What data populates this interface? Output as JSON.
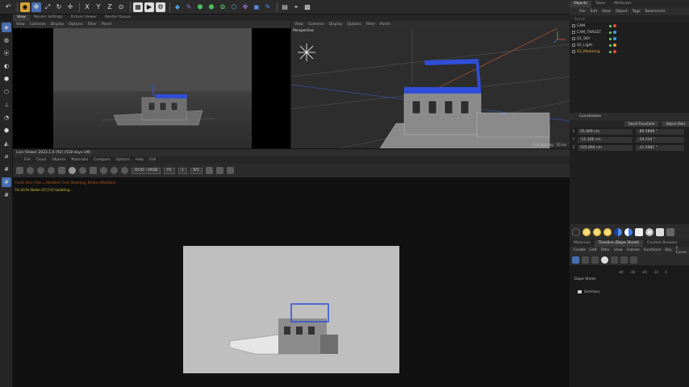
{
  "toolbar": {
    "icons": [
      "undo-icon",
      "select-icon",
      "move-icon",
      "scale-icon",
      "rotate-icon",
      "transform-icon",
      "x-axis-icon",
      "y-axis-icon",
      "z-axis-icon",
      "coordinate-icon",
      "render-region-icon",
      "render-view-icon",
      "render-settings-icon",
      "cube-icon",
      "spline-pen-icon",
      "subdivision-icon",
      "array-icon",
      "cloner-icon",
      "deformer-icon",
      "scene-icon",
      "camera-icon",
      "light-icon",
      "grid-icon",
      "snap-icon",
      "workplane-icon"
    ],
    "x_axis_label": "X",
    "y_axis_label": "Y",
    "z_axis_label": "Z"
  },
  "tabs": [
    "View",
    "Render Settings",
    "Picture Viewer",
    "Render Queue"
  ],
  "viewport_left": {
    "menu": [
      "View",
      "Cameras",
      "Display",
      "Options",
      "Filter",
      "Panel"
    ]
  },
  "viewport_right": {
    "menu": [
      "View",
      "Cameras",
      "Display",
      "Options",
      "Filter",
      "Panel"
    ],
    "label": "Perspective",
    "grid_spacing": "Grid Spacing : 50 cm"
  },
  "live_viewer": {
    "title": "Live Viewer 2023.1.0 (R2) (518 days left)",
    "menu": [
      "File",
      "Cloud",
      "Objects",
      "Materials",
      "Compare",
      "Options",
      "Help",
      "GUI"
    ],
    "color_space": "OCIO - sRGB",
    "field_p": "P1",
    "field_one": "1",
    "field_zoom": "0/5",
    "log": [
      "Check files (Files = Modified Time, Modeling, Media) (Modified)",
      "Tm:20.9s  Nodes:25  [C4] Updating..."
    ]
  },
  "objects_panel": {
    "tabs": [
      "Objects",
      "Takes",
      "Attributes"
    ],
    "menu": [
      "File",
      "Edit",
      "View",
      "Object",
      "Tags",
      "Bookmarks"
    ],
    "search_placeholder": "Search",
    "items": [
      {
        "name": "CAM",
        "tag": "#e84c3d"
      },
      {
        "name": "CAM_TARGET",
        "tag": "#3aa0e8"
      },
      {
        "name": "01_SKY",
        "tag": "#3aa0e8"
      },
      {
        "name": "02_Light",
        "tag": "#e8a53a"
      },
      {
        "name": "03_Modeling",
        "tag": "#e84c3d"
      }
    ]
  },
  "coordinates": {
    "title": "Coordinates",
    "tabs": [
      "Reset Transform",
      "Object (Rel)"
    ],
    "rows": [
      {
        "axis": "X",
        "position": "25.469 cm",
        "rotation": "-89.5868 °"
      },
      {
        "axis": "Y",
        "position": "-11.346 cm",
        "rotation": "-14.314 °"
      },
      {
        "axis": "Z",
        "position": "105.894 cm",
        "rotation": "-11.5981 °"
      }
    ]
  },
  "timeline": {
    "tabs": [
      "Materials",
      "Timeline (Dope Sheet)",
      "Content Browser"
    ],
    "menu": [
      "Create",
      "Edit",
      "Filter",
      "View",
      "Frames",
      "Functions",
      "Key",
      "F-Curve"
    ],
    "ruler": [
      "-40",
      "-30",
      "-20",
      "-10",
      "0"
    ],
    "dope_sheet_label": "Dope Sheet",
    "summary_label": "Summary"
  }
}
